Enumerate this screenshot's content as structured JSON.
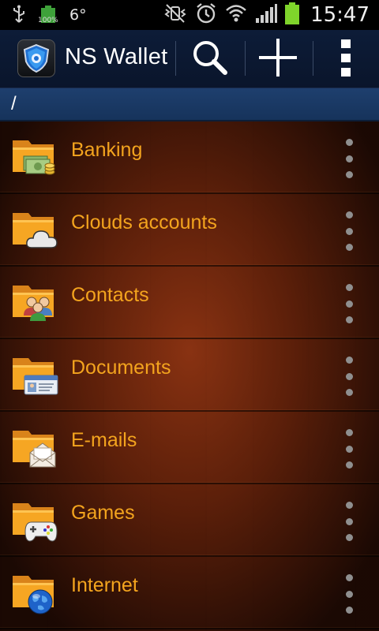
{
  "status_bar": {
    "usb_icon": "usb-icon",
    "battery_small_label": "100%",
    "temperature": "6°",
    "icons": [
      "vibrate-mute-icon",
      "alarm-icon",
      "wifi-icon",
      "signal-icon",
      "battery-icon"
    ],
    "clock": "15:47"
  },
  "action_bar": {
    "title": "NS Wallet",
    "logo_icon": "shield-logo-icon",
    "actions": [
      {
        "name": "search",
        "icon": "search-icon"
      },
      {
        "name": "add",
        "icon": "plus-icon"
      },
      {
        "name": "overflow",
        "icon": "overflow-menu-icon"
      }
    ]
  },
  "path": "/",
  "colors": {
    "label": "#f3a41e",
    "folder": "#f6a623",
    "action_bar": "#0d1c38",
    "path_bar": "#1e3f6e"
  },
  "items": [
    {
      "label": "Banking",
      "icon": "banknotes-icon"
    },
    {
      "label": "Clouds accounts",
      "icon": "cloud-icon"
    },
    {
      "label": "Contacts",
      "icon": "people-icon"
    },
    {
      "label": "Documents",
      "icon": "id-card-icon"
    },
    {
      "label": "E-mails",
      "icon": "envelope-icon"
    },
    {
      "label": "Games",
      "icon": "gamepad-icon"
    },
    {
      "label": "Internet",
      "icon": "globe-icon"
    }
  ]
}
